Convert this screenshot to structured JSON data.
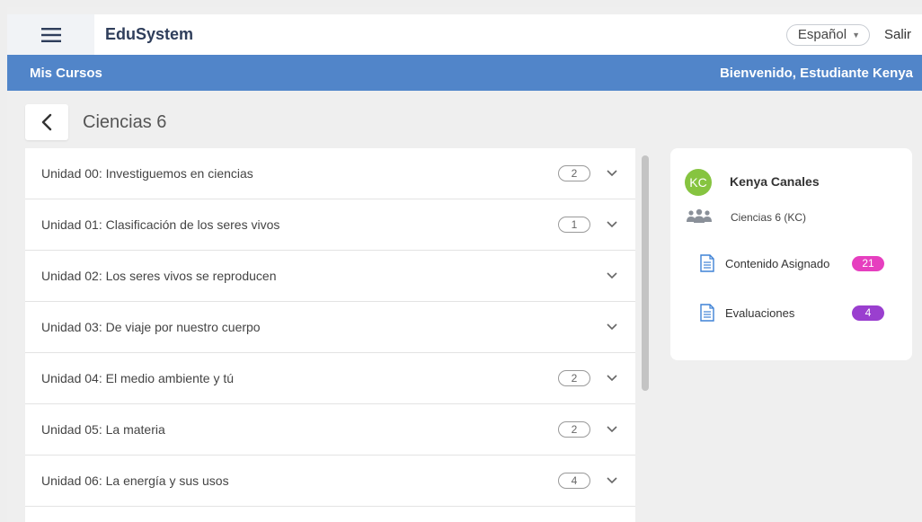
{
  "header": {
    "brand": "EduSystem",
    "language": "Español",
    "logout": "Salir"
  },
  "nav_bar": {
    "section": "Mis Cursos",
    "welcome": "Bienvenido, Estudiante Kenya"
  },
  "course": {
    "title": "Ciencias 6"
  },
  "units": [
    {
      "label": "Unidad 00: Investiguemos en ciencias",
      "count": "2"
    },
    {
      "label": "Unidad 01: Clasificación de los seres vivos",
      "count": "1"
    },
    {
      "label": "Unidad 02: Los seres vivos se reproducen",
      "count": ""
    },
    {
      "label": "Unidad 03: De viaje por nuestro cuerpo",
      "count": ""
    },
    {
      "label": "Unidad 04: El medio ambiente y tú",
      "count": "2"
    },
    {
      "label": "Unidad 05: La materia",
      "count": "2"
    },
    {
      "label": "Unidad 06: La energía y sus usos",
      "count": "4"
    }
  ],
  "profile": {
    "initials": "KC",
    "name": "Kenya Canales",
    "group": "Ciencias 6 (KC)",
    "assigned_label": "Contenido Asignado",
    "assigned_count": "21",
    "evaluations_label": "Evaluaciones",
    "evaluations_count": "4"
  },
  "colors": {
    "accent_blue": "#5185c9",
    "avatar_green": "#86c440",
    "assigned_badge": "#e63fbf",
    "evaluations_badge": "#9a3fcf",
    "icon_blue": "#3f82d6"
  }
}
